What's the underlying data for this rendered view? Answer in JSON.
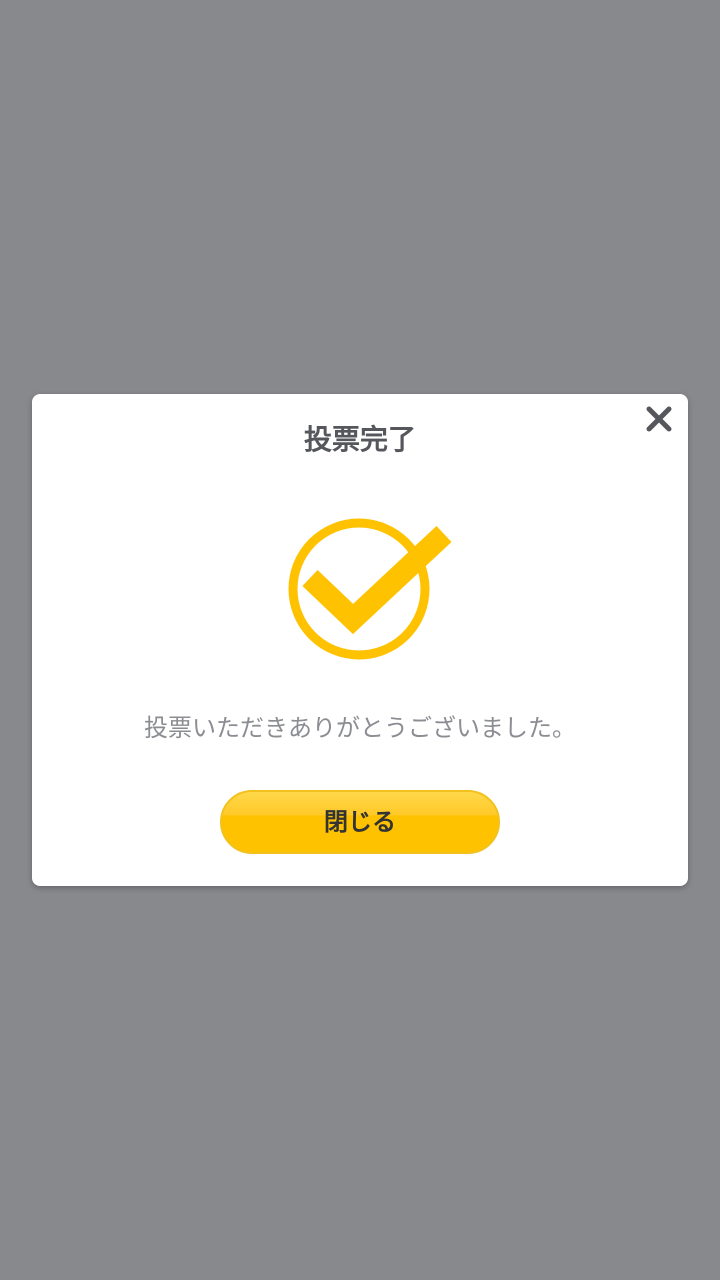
{
  "dialog": {
    "title": "投票完了",
    "message": "投票いただきありがとうございました。",
    "close_button_label": "閉じる",
    "close_icon": "close-icon",
    "status_icon": "check-circle-icon"
  },
  "colors": {
    "backdrop": "#88898d",
    "accent": "#ffc200",
    "title_text": "#55575c",
    "message_text": "#8b8d92"
  }
}
